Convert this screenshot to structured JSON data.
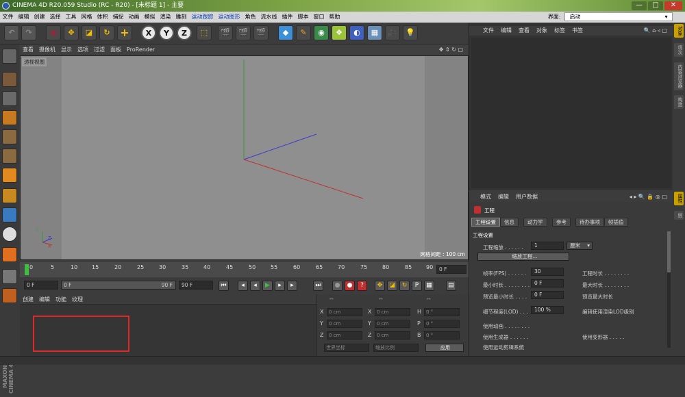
{
  "window": {
    "title": "CINEMA 4D R20.059 Studio (RC - R20) - [未标题 1] - 主要",
    "min": "—",
    "max": "□",
    "close": "✕"
  },
  "menubar": {
    "items": [
      "文件",
      "编辑",
      "创建",
      "选择",
      "工具",
      "网格",
      "体积",
      "捕捉",
      "动画",
      "模拟",
      "渲染",
      "雕刻",
      "运动跟踪",
      "运动图形",
      "角色",
      "流水线",
      "插件",
      "脚本",
      "窗口",
      "帮助"
    ],
    "layout_label": "界面:",
    "layout_value": "启动"
  },
  "toolbar": {
    "axis_x": "X",
    "axis_y": "Y",
    "axis_z": "Z"
  },
  "viewport": {
    "menu": [
      "查看",
      "摄像机",
      "显示",
      "选项",
      "过滤",
      "面板",
      "ProRender"
    ],
    "label": "透视视图",
    "grid": "网格间距 : 100 cm",
    "axis_x": "X",
    "axis_y": "Y",
    "axis_z": "Z"
  },
  "timeline": {
    "ticks": [
      "0",
      "5",
      "10",
      "15",
      "20",
      "25",
      "30",
      "35",
      "40",
      "45",
      "50",
      "55",
      "60",
      "65",
      "70",
      "75",
      "80",
      "85",
      "90"
    ],
    "frame_field": "0 F"
  },
  "transport": {
    "start": "0 F",
    "range_start": "0 F",
    "range_end": "90 F",
    "end": "90 F"
  },
  "material": {
    "menu": [
      "创建",
      "编辑",
      "功能",
      "纹理"
    ]
  },
  "coords": {
    "headers": [
      "--",
      "--",
      "--"
    ],
    "rows": [
      [
        "X",
        "0 cm",
        "X",
        "0 cm",
        "H",
        "0 °"
      ],
      [
        "Y",
        "0 cm",
        "Y",
        "0 cm",
        "P",
        "0 °"
      ],
      [
        "Z",
        "0 cm",
        "Z",
        "0 cm",
        "B",
        "0 °"
      ]
    ],
    "mode1": "世界坐标",
    "mode2": "缩放比例",
    "apply": "应用"
  },
  "objects": {
    "menu": [
      "文件",
      "编辑",
      "查看",
      "对象",
      "标签",
      "书签"
    ]
  },
  "right_strip": [
    "对象",
    "场次",
    "内容浏览器",
    "构造",
    "属性",
    "层"
  ],
  "attributes": {
    "menu": [
      "模式",
      "编辑",
      "用户数据"
    ],
    "title": "工程",
    "tabs": [
      "工程设置",
      "信息",
      "动力学",
      "参考",
      "待办事项",
      "帧插值"
    ],
    "section": "工程设置",
    "scale_label": "工程缩放 . . . . . .",
    "scale_value": "1",
    "scale_unit": "厘米",
    "scale_button": "缩放工程...",
    "fps_label": "帧率(FPS) . . . . . .",
    "fps_value": "30",
    "project_time_label": "工程时长 . . . . . . . .",
    "min_time_label": "最小时长 . . . . . . . .",
    "min_time_value": "0 F",
    "max_time_label": "最大时长 . . . . . . . .",
    "pmin_label": "预览最小时长 . . . .",
    "pmin_value": "0 F",
    "pmax_label": "预览最大时长",
    "lod_label": "细节程度(LOD) . . .",
    "lod_value": "100 %",
    "lod_render_label": "编辑使用渲染LOD级别",
    "anim_label": "使用动画 . . . . . . . .",
    "gen_label": "使用生成器 . . . . . .",
    "deform_label": "使用变形器 . . . . .",
    "mograph_label": "使用运动剪辑系统"
  }
}
